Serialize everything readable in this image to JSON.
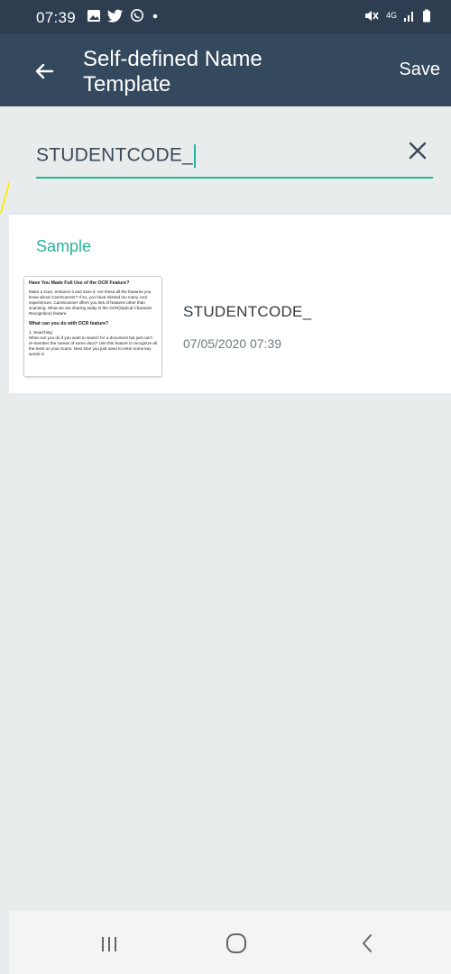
{
  "status_bar": {
    "time": "07:39",
    "network": "4G",
    "icons": [
      "gallery-icon",
      "twitter-icon",
      "whatsapp-icon",
      "dot-icon",
      "mute-icon",
      "signal-icon",
      "battery-icon"
    ]
  },
  "app_bar": {
    "title": "Self-defined Name Template",
    "save_label": "Save",
    "bg_color": "#34495e"
  },
  "name_input": {
    "value": "STUDENTCODE_",
    "accent_color": "#26b39b"
  },
  "sample": {
    "label": "Sample",
    "document_name": "STUDENTCODE_",
    "document_date": "07/05/2020 07:39",
    "thumbnail": {
      "heading": "Have You Made Full Use of the OCR Feature?",
      "paragraph": "Make a scan, enhance it and save it. Are these all the features you know about CamScanner? If so, you have missed too many cool experiences. CamScanner offers you lots of features other than scanning. What we are sharing today is the OCR(Optical Character Recognition) feature.",
      "subheading": "What can you do with OCR feature?",
      "item": "1. Searching",
      "item_text": "What can you do if you want to search for a document but just can't re-member the names of some docs? Use this feature to recognize all the texts on your scans. Next time you just need to enter some key words in"
    }
  },
  "nav_bar": {
    "icons": [
      "recent-apps-icon",
      "home-icon",
      "back-icon"
    ]
  }
}
